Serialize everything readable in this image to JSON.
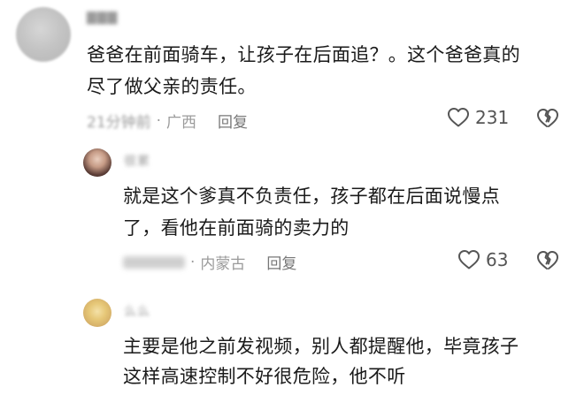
{
  "comments": [
    {
      "author": "▇▇▇",
      "text_line1": "爸爸在前面骑车，让孩子在后面追？。这个爸爸真的",
      "text_line2": "尽了做父亲的责任。",
      "time": "21分钟前",
      "location": "广西",
      "reply_label": "回复",
      "likes": "231"
    },
    {
      "author": "很累",
      "text_line1": "就是这个爹真不负责任，孩子都在后面说慢点",
      "text_line2": "了，看他在前面骑的卖力的",
      "location": "内蒙古",
      "reply_label": "回复",
      "likes": "63"
    },
    {
      "author": "么么",
      "text_line1": "主要是他之前发视频，别人都提醒他，毕竟孩子",
      "text_line2": "这样高速控制不好很危险，他不听"
    }
  ],
  "icons": {
    "like": "heart-outline-icon",
    "dislike": "broken-heart-icon"
  },
  "colors": {
    "text": "#1a1a1a",
    "meta": "#9b9b9b",
    "icon": "#555555"
  }
}
